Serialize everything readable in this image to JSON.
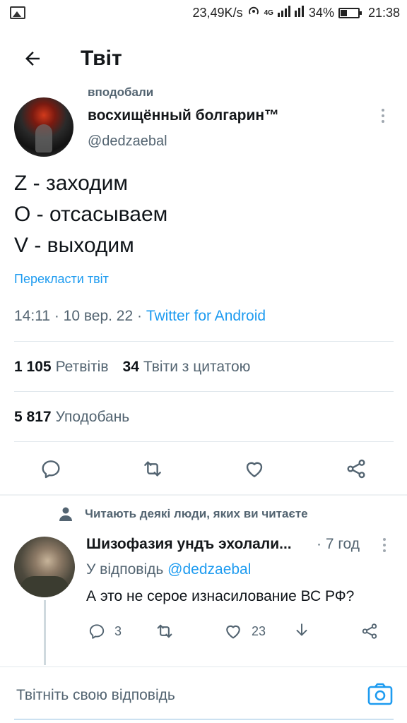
{
  "status_bar": {
    "speed": "23,49K/s",
    "network": "4G",
    "battery": "34%",
    "time": "21:38",
    "icons": [
      "image-icon",
      "hotspot-icon",
      "signal-icon",
      "battery-icon"
    ]
  },
  "header": {
    "title": "Твіт"
  },
  "tweet": {
    "liked_banner": "вподобали",
    "author_name": "восхищённый болгарин™",
    "author_handle": "@dedzaebal",
    "lines": [
      "Z - заходим",
      "O - отсасываем",
      "V - выходим"
    ],
    "translate_label": "Перекласти твіт",
    "timestamp": "14:11 · 10 вер. 22 · ",
    "source": "Twitter for Android",
    "retweets_count": "1 105",
    "retweets_label": "Ретвітів",
    "quotes_count": "34",
    "quotes_label": "Твіти з цитатою",
    "likes_count": "5 817",
    "likes_label": "Уподобань"
  },
  "reply": {
    "social_context": "Читають деякі люди, яких ви читаєте",
    "author_name": "Шизофазия ундъ эхолали...",
    "time": "· 7 год",
    "replying_to_prefix": "У відповідь ",
    "replying_to_handle": "@dedzaebal",
    "text": "А это не серое изнасилование ВС РФ?",
    "reply_count": "3",
    "like_count": "23"
  },
  "composer": {
    "placeholder": "Твітніть свою відповідь"
  },
  "colors": {
    "accent": "#1d9bf0",
    "secondary_text": "#536471",
    "primary_text": "#0f1419"
  }
}
